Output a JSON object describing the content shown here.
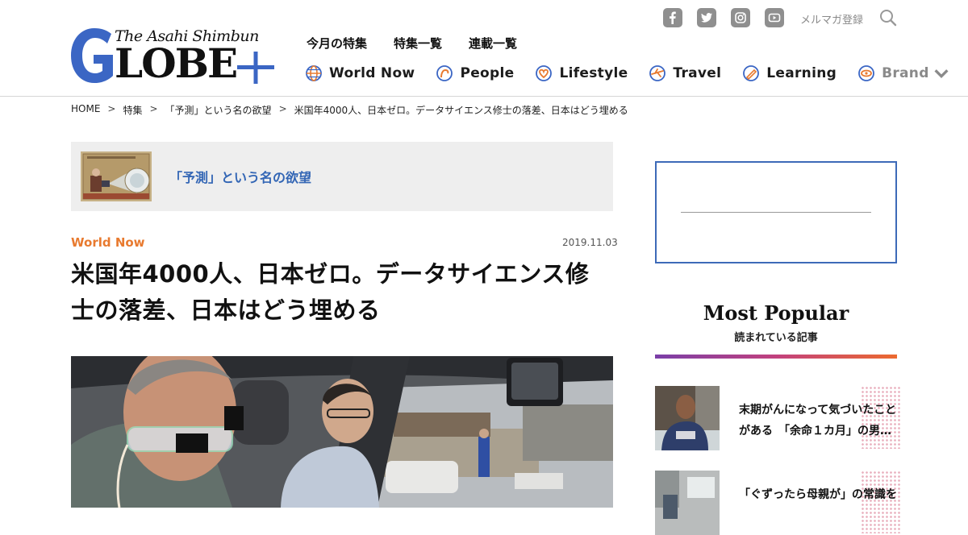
{
  "brand": {
    "tagline": "The Asahi Shimbun",
    "wordmark": "LOBE",
    "colors": {
      "logo_blue": "#3b66c4",
      "accent_orange": "#e87a2f",
      "link_blue": "#3366b5",
      "ad_border": "#3d6ab8"
    }
  },
  "header": {
    "social": [
      {
        "icon": "facebook-icon"
      },
      {
        "icon": "twitter-icon"
      },
      {
        "icon": "instagram-icon"
      },
      {
        "icon": "youtube-icon"
      }
    ],
    "newsletter": "メルマガ登録",
    "search_icon": "search-icon",
    "top_links": [
      "今月の特集",
      "特集一覧",
      "連載一覧"
    ],
    "categories": [
      {
        "label": "World Now",
        "icon": "globe-icon"
      },
      {
        "label": "People",
        "icon": "people-icon"
      },
      {
        "label": "Lifestyle",
        "icon": "lifestyle-icon"
      },
      {
        "label": "Travel",
        "icon": "travel-icon"
      },
      {
        "label": "Learning",
        "icon": "learning-icon"
      },
      {
        "label": "Brand",
        "icon": "brand-icon"
      }
    ]
  },
  "breadcrumb": {
    "items": [
      "HOME",
      "特集",
      "「予測」という名の欲望",
      "米国年4000人、日本ゼロ。データサイエンス修士の落差、日本はどう埋める"
    ],
    "separator": ">"
  },
  "feature": {
    "title": "「予測」という名の欲望"
  },
  "article": {
    "category": "World Now",
    "date": "2019.11.03",
    "title": "米国年4000人、日本ゼロ。データサイエンス修士の落差、日本はどう埋める"
  },
  "sidebar": {
    "popular_title": "Most Popular",
    "popular_subtitle": "読まれている記事",
    "items": [
      {
        "text": "末期がんになって気づいたことがある　「余命１カ月」の男…"
      },
      {
        "text": "「ぐずったら母親が」の常識を"
      }
    ]
  }
}
